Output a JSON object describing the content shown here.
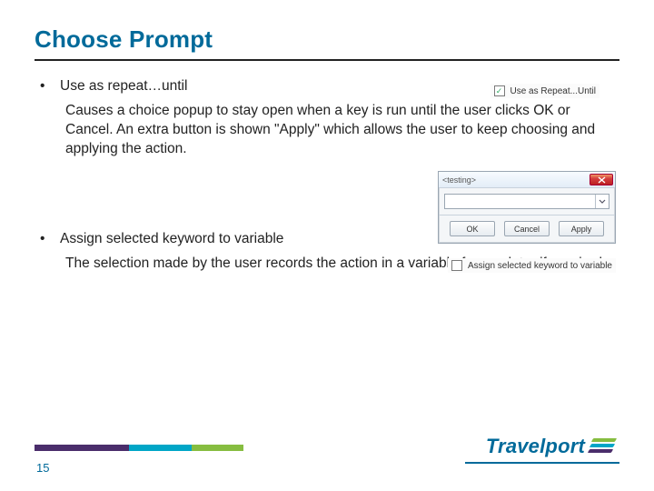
{
  "title": "Choose Prompt",
  "bullets": [
    {
      "lead": "Use as repeat…until",
      "desc": "Causes a choice popup to stay open when a key is run until the user clicks OK or Cancel. An extra button is shown \"Apply\" which allows the user to keep choosing and applying the action."
    },
    {
      "lead": "Assign selected keyword to variable",
      "desc": "The selection made by the user records the action in a variable for use later if required."
    }
  ],
  "checkbox1": {
    "checked": true,
    "label": "Use as Repeat...Until"
  },
  "checkbox2": {
    "checked": false,
    "label": "Assign selected keyword to variable"
  },
  "dialog": {
    "title": "<testing>",
    "buttons": {
      "ok": "OK",
      "cancel": "Cancel",
      "apply": "Apply"
    }
  },
  "page_number": "15",
  "brand": "Travelport"
}
